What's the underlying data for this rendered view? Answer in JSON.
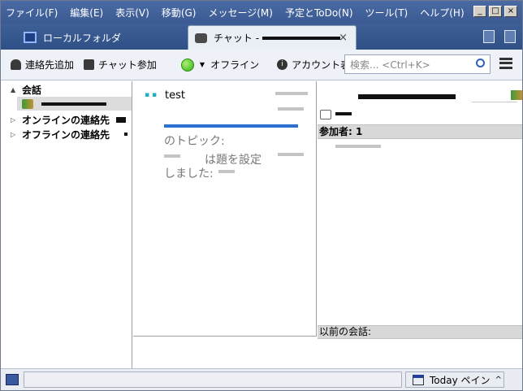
{
  "menubar": {
    "items": [
      "ファイル(F)",
      "編集(E)",
      "表示(V)",
      "移動(G)",
      "メッセージ(M)",
      "予定とToDo(N)",
      "ツール(T)",
      "ヘルプ(H)"
    ],
    "window_controls": {
      "minimize": "_",
      "maximize": "□",
      "close": "×"
    }
  },
  "tabs": {
    "folder": "ローカルフォルダ",
    "chat": "チャット -",
    "close_glyph": "×"
  },
  "toolbar": {
    "add_contact": "連絡先追加",
    "join_chat": "チャット参加",
    "status": "オフライン",
    "account": "アカウント表示",
    "search_placeholder": "検索... <Ctrl+K>"
  },
  "contacts": {
    "conversations": "会話",
    "online": "オンラインの連絡先",
    "offline": "オフラインの連絡先"
  },
  "chat": {
    "message": "test",
    "topic_label": "のトピック:",
    "topic_set": "は題を設定",
    "topic_done": "しました:"
  },
  "right_pane": {
    "participants": "参加者: 1",
    "previous": "以前の会話:"
  },
  "statusbar": {
    "today_pane": "Today ペイン",
    "chevron": "^"
  },
  "colors": {
    "menubar": "#3b5a93",
    "accent": "#2060c0",
    "online_status": "#38b01a"
  }
}
